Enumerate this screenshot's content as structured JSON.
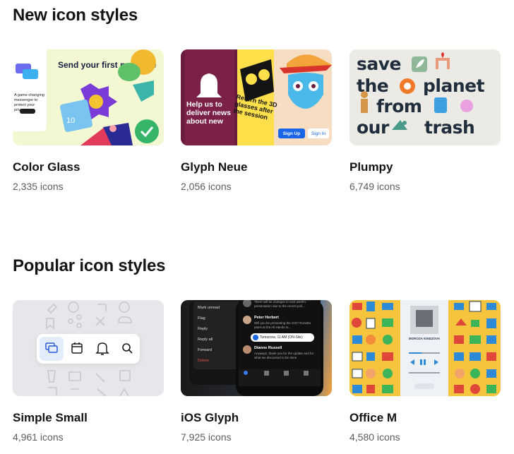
{
  "sections": [
    {
      "title": "New icon styles",
      "cards": [
        {
          "name": "Color Glass",
          "count": "2,335 icons",
          "thumb": {
            "headline": "Send your first message",
            "small_text": "A game-changing messenger to protect your privacy",
            "badge": "10"
          }
        },
        {
          "name": "Glyph Neue",
          "count": "2,056 icons",
          "thumb": {
            "help_text": "Help us to deliver news about new",
            "return_text": "Return the 3D glasses after the session",
            "signup": "Sign Up",
            "signin": "Sign In"
          }
        },
        {
          "name": "Plumpy",
          "count": "6,749 icons",
          "thumb": {
            "words": [
              "save",
              "the",
              "planet",
              "from",
              "our",
              "trash"
            ]
          }
        }
      ]
    },
    {
      "title": "Popular icon styles",
      "cards": [
        {
          "name": "Simple Small",
          "count": "4,961 icons"
        },
        {
          "name": "iOS Glyph",
          "count": "7,925 icons",
          "thumb": {
            "menu": [
              "Mark unread",
              "Flag",
              "Reply",
              "Reply all",
              "Forward",
              "Delete"
            ],
            "mail": [
              {
                "from": "",
                "text": "There will be changes to next week's presentation due to the recent poli..."
              },
              {
                "from": "Peter Herbert",
                "text": "Will you be presenting the iOS? Ronetta plans at the All Hands te..."
              },
              {
                "from": "Dianne Russell",
                "text": "Anyways, thank you for the update and for what we discussed to be done"
              }
            ],
            "reminder": "Tomorrow, 11 AM (ON-Site)"
          }
        },
        {
          "name": "Office M",
          "count": "4,580 icons",
          "thumb": {
            "artist": "MOROZA KINDZOVA"
          }
        }
      ]
    }
  ],
  "colors": {
    "heading": "#141414",
    "count": "#5c5c5c",
    "accent_blue": "#1a66e6"
  }
}
